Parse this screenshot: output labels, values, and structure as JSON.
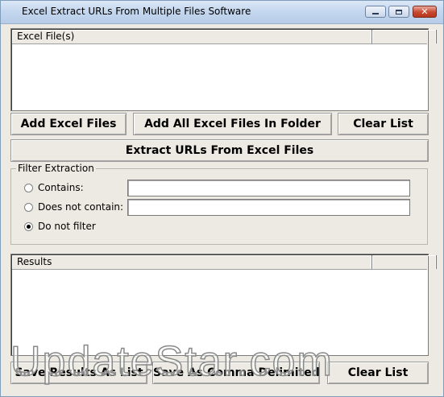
{
  "window": {
    "title": "Excel Extract URLs From Multiple Files Software",
    "controls": {
      "minimize": "minimize-icon",
      "maximize": "maximize-icon",
      "close": "close-icon"
    }
  },
  "excel_files_list": {
    "column_header": "Excel File(s)",
    "rows": []
  },
  "file_buttons": {
    "add_files": "Add Excel Files",
    "add_folder": "Add All Excel Files In Folder",
    "clear": "Clear List"
  },
  "extract_button": "Extract URLs From Excel Files",
  "filter": {
    "group_label": "Filter Extraction",
    "options": [
      {
        "label": "Contains:",
        "selected": false,
        "value": ""
      },
      {
        "label": "Does not contain:",
        "selected": false,
        "value": ""
      },
      {
        "label": "Do not filter",
        "selected": true
      }
    ]
  },
  "results_list": {
    "column_header": "Results",
    "rows": []
  },
  "result_buttons": {
    "save_list": "Save Results As List",
    "save_comma": "Save As Comma Delimited",
    "clear": "Clear List"
  },
  "watermark": "UpdateStar.com",
  "colors": {
    "window_bg": "#eceae2",
    "titlebar": "#c3d6ee",
    "close_button": "#c8472f"
  }
}
